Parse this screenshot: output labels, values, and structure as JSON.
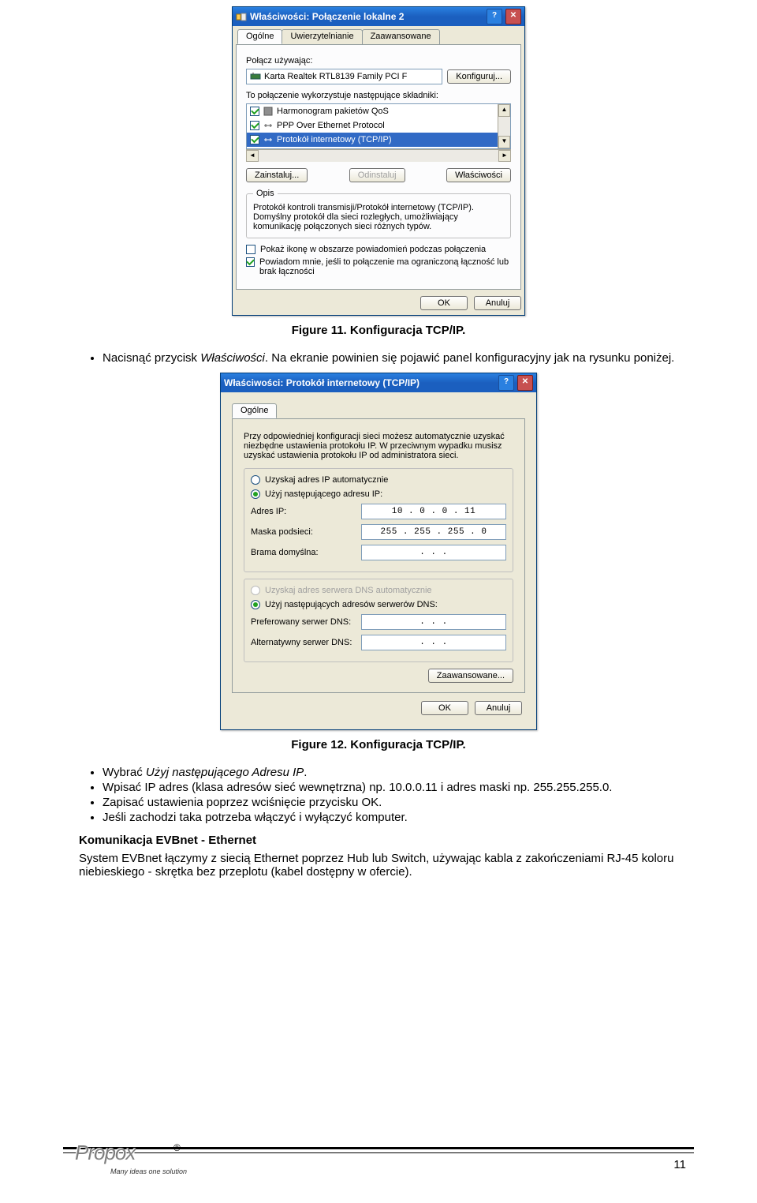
{
  "window1": {
    "title": "Właściwości: Połączenie lokalne 2",
    "help": "?",
    "close": "✕",
    "tabs": {
      "general": "Ogólne",
      "auth": "Uwierzytelnianie",
      "advanced": "Zaawansowane"
    },
    "connect_using_label": "Połącz używając:",
    "adapter": "Karta Realtek RTL8139 Family PCI F",
    "configure_btn": "Konfiguruj...",
    "components_label": "To połączenie wykorzystuje następujące składniki:",
    "components": {
      "a": "Harmonogram pakietów QoS",
      "b": "PPP Over Ethernet Protocol",
      "c": "Protokół internetowy (TCP/IP)"
    },
    "install_btn": "Zainstaluj...",
    "uninstall_btn": "Odinstaluj",
    "properties_btn": "Właściwości",
    "desc_legend": "Opis",
    "desc_text": "Protokół kontroli transmisji/Protokół internetowy (TCP/IP). Domyślny protokół dla sieci rozległych, umożliwiający komunikację połączonych sieci różnych typów.",
    "check1_label": "Pokaż ikonę w obszarze powiadomień podczas połączenia",
    "check2_label": "Powiadom mnie, jeśli to połączenie ma ograniczoną łączność lub brak łączności",
    "ok_btn": "OK",
    "cancel_btn": "Anuluj"
  },
  "caption1": "Figure 11. Konfiguracja TCP/IP.",
  "bullet1_a": "Nacisnąć przycisk ",
  "bullet1_b": "Właściwości",
  "bullet1_c": ". Na ekranie powinien się pojawić panel konfiguracyjny jak na rysunku poniżej.",
  "window2": {
    "title": "Właściwości: Protokół internetowy (TCP/IP)",
    "help": "?",
    "close": "✕",
    "tab_general": "Ogólne",
    "intro": "Przy odpowiedniej konfiguracji sieci możesz automatycznie uzyskać niezbędne ustawienia protokołu IP. W przeciwnym wypadku musisz uzyskać ustawienia protokołu IP od administratora sieci.",
    "radio_auto_ip": "Uzyskaj adres IP automatycznie",
    "radio_man_ip": "Użyj następującego adresu IP:",
    "ip_label": "Adres IP:",
    "ip_value": "10 .  0 .  0 . 11",
    "mask_label": "Maska podsieci:",
    "mask_value": "255 . 255 . 255 .  0",
    "gateway_label": "Brama domyślna:",
    "gateway_value": ".      .      .",
    "radio_auto_dns": "Uzyskaj adres serwera DNS automatycznie",
    "radio_man_dns": "Użyj następujących adresów serwerów DNS:",
    "dns1_label": "Preferowany serwer DNS:",
    "dns1_value": ".      .      .",
    "dns2_label": "Alternatywny serwer DNS:",
    "dns2_value": ".      .      .",
    "advanced_btn": "Zaawansowane...",
    "ok_btn": "OK",
    "cancel_btn": "Anuluj"
  },
  "caption2": "Figure 12. Konfiguracja TCP/IP.",
  "bullets2": {
    "a1": "Wybrać ",
    "a2": "Użyj następującego Adresu IP",
    "a3": ".",
    "b": "Wpisać IP adres (klasa adresów sieć wewnętrzna) np. 10.0.0.11 i adres maski np. 255.255.255.0.",
    "c": "Zapisać ustawienia poprzez wciśnięcie przycisku OK.",
    "d": "Jeśli zachodzi taka potrzeba włączyć i wyłączyć komputer."
  },
  "section_title": "Komunikacja EVBnet - Ethernet",
  "section_text": "System EVBnet łączymy z siecią Ethernet poprzez Hub lub Switch, używając kabla z zakończeniami RJ-45 koloru niebieskiego - skrętka bez przeplotu (kabel dostępny w ofercie).",
  "logo": "Propox",
  "tagline": "Many ideas one solution",
  "reg": "®",
  "page_num": "11"
}
